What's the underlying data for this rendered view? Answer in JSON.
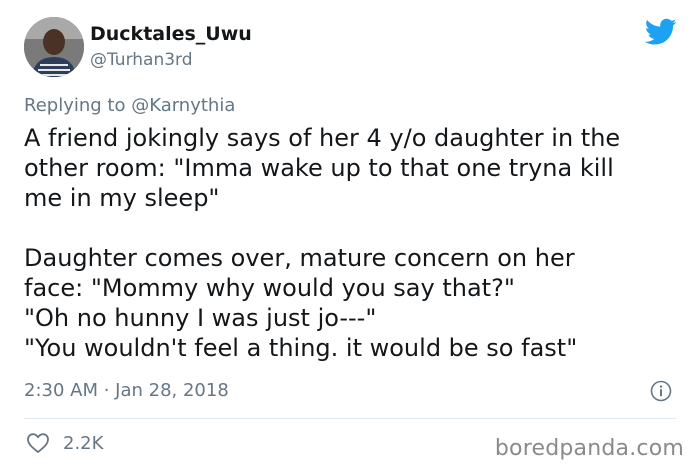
{
  "tweet": {
    "display_name": "Ducktales_Uwu",
    "handle": "@Turhan3rd",
    "replying_prefix": "Replying to ",
    "replying_to": "@Karnythia",
    "body_lines": [
      "A friend jokingly says of her 4 y/o daughter in the",
      "other room: \"Imma wake up to that one tryna kill",
      "me in my sleep\"",
      "Daughter comes over, mature concern on her",
      "face: \"Mommy why would you say that?\"",
      "\"Oh no hunny I was just jo---\"",
      "\"You wouldn't feel a thing. it would be so fast\""
    ],
    "timestamp": "2:30 AM · Jan 28, 2018",
    "likes": "2.2K"
  },
  "watermark": "boredpanda.com",
  "colors": {
    "twitter_blue": "#1da1f2",
    "secondary_text": "#657786",
    "primary_text": "#14171a",
    "divider": "#e1e8ed"
  },
  "icons": [
    "twitter-bird-icon",
    "info-icon",
    "heart-icon"
  ]
}
